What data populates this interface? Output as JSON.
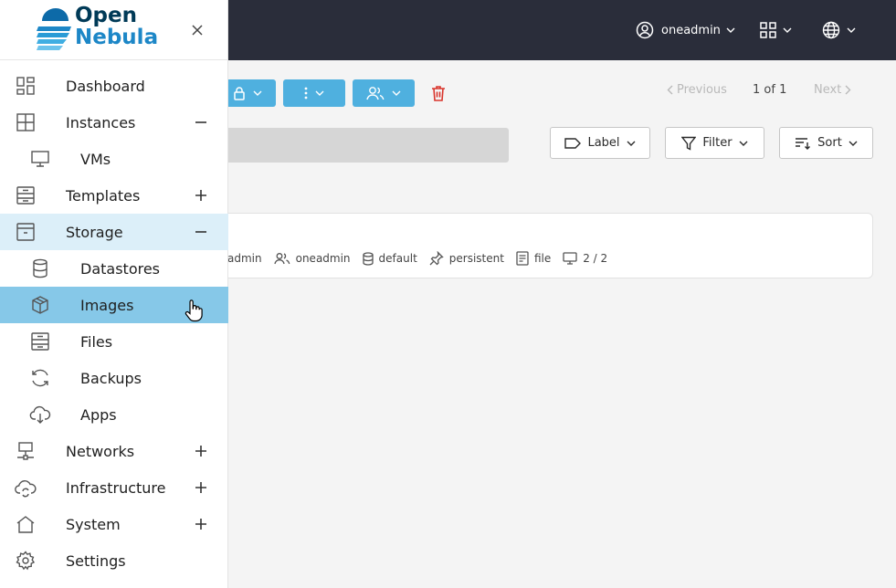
{
  "header": {
    "user": "oneadmin"
  },
  "brand": {
    "line1": "Open",
    "line2": "Nebula"
  },
  "sidebar": {
    "items": [
      {
        "label": "Dashboard",
        "icon": "dashboard-icon"
      },
      {
        "label": "Instances",
        "icon": "instances-icon",
        "expander": "minus"
      },
      {
        "label": "VMs",
        "icon": "monitor-icon"
      },
      {
        "label": "Templates",
        "icon": "templates-icon",
        "expander": "plus"
      },
      {
        "label": "Storage",
        "icon": "storage-icon",
        "expander": "minus"
      },
      {
        "label": "Datastores",
        "icon": "database-icon"
      },
      {
        "label": "Images",
        "icon": "box-icon"
      },
      {
        "label": "Files",
        "icon": "files-icon"
      },
      {
        "label": "Backups",
        "icon": "refresh-icon"
      },
      {
        "label": "Apps",
        "icon": "cloud-download-icon"
      },
      {
        "label": "Networks",
        "icon": "network-icon",
        "expander": "plus"
      },
      {
        "label": "Infrastructure",
        "icon": "cloud-sync-icon",
        "expander": "plus"
      },
      {
        "label": "System",
        "icon": "home-icon",
        "expander": "plus"
      },
      {
        "label": "Settings",
        "icon": "gear-icon"
      }
    ]
  },
  "toolbar": {
    "previous": "Previous",
    "page": "1 of 1",
    "next": "Next",
    "label_btn": "Label",
    "filter_btn": "Filter",
    "sort_btn": "Sort"
  },
  "image_row": {
    "owner_partial": "admin",
    "group": "oneadmin",
    "datastore": "default",
    "persistency": "persistent",
    "type": "file",
    "vms": "2 / 2"
  },
  "colors": {
    "header_bg": "#2a2d3a",
    "accent": "#4fb0df",
    "selected": "#86c8e8",
    "expanded": "#dceff9",
    "delete": "#d9342b"
  }
}
